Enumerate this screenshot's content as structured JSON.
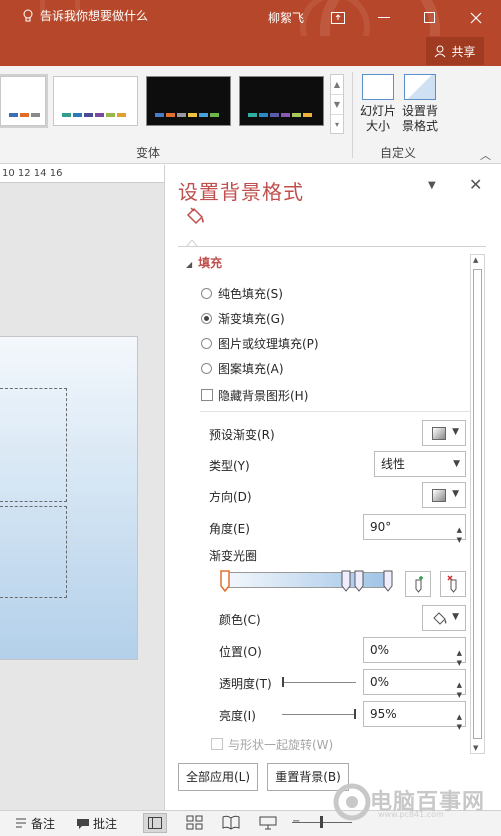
{
  "titlebar": {
    "user_name": "柳絮飞",
    "bg_color": "#b7472a"
  },
  "tellme": {
    "text": "告诉我你想要做什么",
    "share_label": "共享"
  },
  "ribbon": {
    "variants_group_label": "变体",
    "customize_group_label": "自定义",
    "slide_size_label": [
      "幻灯片",
      "大小"
    ],
    "format_bg_label": [
      "设置背",
      "景格式"
    ]
  },
  "ruler": {
    "text": "10 12 14 16"
  },
  "panel": {
    "title": "设置背景格式",
    "section": "填充",
    "fill_options": [
      {
        "label": "纯色填充(S)",
        "selected": false
      },
      {
        "label": "渐变填充(G)",
        "selected": true
      },
      {
        "label": "图片或纹理填充(P)",
        "selected": false
      },
      {
        "label": "图案填充(A)",
        "selected": false
      }
    ],
    "hide_bg_label": "隐藏背景图形(H)",
    "preset_label": "预设渐变(R)",
    "type_label": "类型(Y)",
    "type_value": "线性",
    "direction_label": "方向(D)",
    "angle_label": "角度(E)",
    "angle_value": "90°",
    "stops_label": "渐变光圈",
    "color_label": "颜色(C)",
    "position_label": "位置(O)",
    "position_value": "0%",
    "transparency_label": "透明度(T)",
    "transparency_value": "0%",
    "brightness_label": "亮度(I)",
    "brightness_value": "95%",
    "rotate_label": "与形状一起旋转(W)",
    "apply_all_label": "全部应用(L)",
    "reset_label": "重置背景(B)",
    "accent_color": "#c0504d"
  },
  "statusbar": {
    "notes_label": "备注",
    "comments_label": "批注"
  },
  "watermark": {
    "text": "电脑百事网",
    "sub": "www.pc841.com"
  }
}
